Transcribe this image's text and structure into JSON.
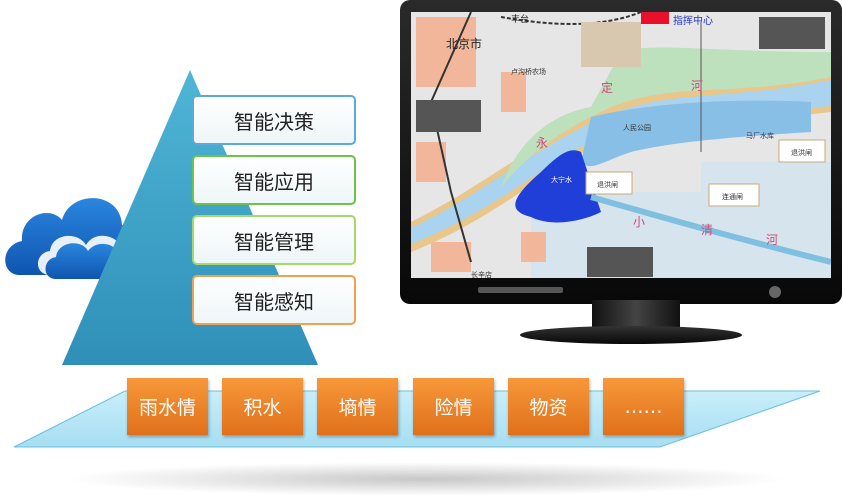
{
  "pyramid": {
    "layers": [
      {
        "label": "智能决策",
        "border": "#5aaad6"
      },
      {
        "label": "智能应用",
        "border": "#6cc24a"
      },
      {
        "label": "智能管理",
        "border": "#a6d86a"
      },
      {
        "label": "智能感知",
        "border": "#f0a050"
      }
    ],
    "color": "#3a9fc4"
  },
  "cloud": {
    "icon": "cloud-icon",
    "color": "#1b6fc8"
  },
  "monitor": {
    "map_labels": {
      "fengtai": "丰台",
      "beijing": "北京市",
      "command_center": "指挥中心",
      "lugouqiao": "卢沟桥农场",
      "yong": "永",
      "ding": "定",
      "he": "河",
      "park": "人民公园",
      "daning": "大宁水",
      "machang": "马厂水库",
      "gate1": "退洪闸",
      "gate2": "连通闸",
      "gate3": "退洪闸",
      "xiao": "小",
      "qing": "清",
      "he2": "河",
      "changxindian": "长辛店"
    }
  },
  "platform": {
    "items": [
      "雨水情",
      "积水",
      "墒情",
      "险情",
      "物资",
      "……"
    ],
    "tile_color": "#f08a2c"
  }
}
